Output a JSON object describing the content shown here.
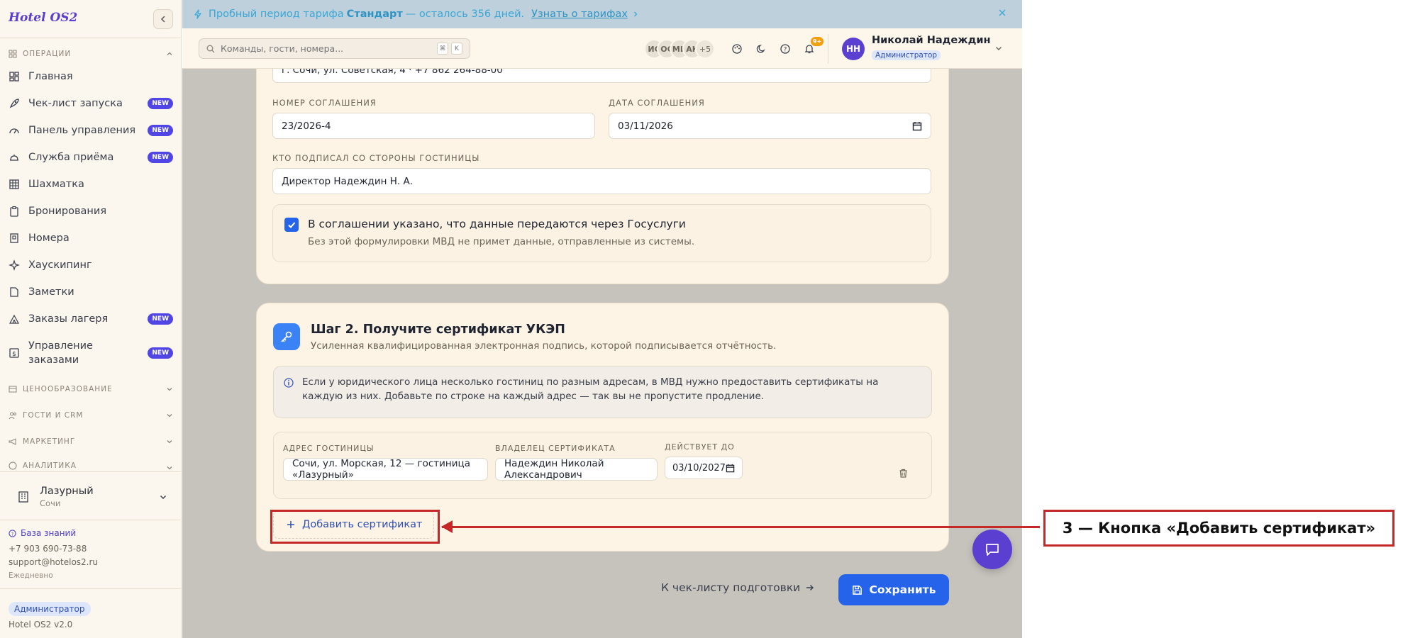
{
  "app": {
    "brand": "Hotel OS2"
  },
  "sidebar": {
    "sections": {
      "operations": "ОПЕРАЦИИ",
      "pricing": "ЦЕНООБРАЗОВАНИЕ",
      "guests": "ГОСТИ И CRM",
      "marketing": "МАРКЕТИНГ",
      "analytics": "АНАЛИТИКА"
    },
    "items": [
      {
        "label": "Главная",
        "badge": "",
        "icon": "dashboard-icon"
      },
      {
        "label": "Чек-лист запуска",
        "badge": "NEW",
        "icon": "rocket-icon"
      },
      {
        "label": "Панель управления",
        "badge": "NEW",
        "icon": "gauge-icon"
      },
      {
        "label": "Служба приёма",
        "badge": "NEW",
        "icon": "bell-icon"
      },
      {
        "label": "Шахматка",
        "badge": "",
        "icon": "grid-icon"
      },
      {
        "label": "Бронирования",
        "badge": "",
        "icon": "clipboard-icon"
      },
      {
        "label": "Номера",
        "badge": "",
        "icon": "building-icon"
      },
      {
        "label": "Хаускипинг",
        "badge": "",
        "icon": "sparkle-icon"
      },
      {
        "label": "Заметки",
        "badge": "",
        "icon": "note-icon"
      },
      {
        "label": "Заказы лагеря",
        "badge": "NEW",
        "icon": "tent-icon"
      },
      {
        "label": "Управление заказами",
        "badge": "NEW",
        "icon": "dollar-icon"
      }
    ],
    "hotel": {
      "name": "Лазурный",
      "city": "Сочи"
    },
    "knowledge_base": "База знаний",
    "phone": "+7 903 690-73-88",
    "email": "support@hotelos2.ru",
    "hours": "Ежедневно",
    "role": "Администратор",
    "version": "Hotel OS2 v2.0"
  },
  "banner": {
    "text_before": "Пробный период тарифа",
    "plan": "Стандарт",
    "text_after": "— осталось 356 дней.",
    "link": "Узнать о тарифах"
  },
  "header": {
    "search_placeholder": "Команды, гости, номера...",
    "kbd1": "⌘",
    "kbd2": "K",
    "avatars": [
      "ИС",
      "ОС",
      "МИ",
      "АК"
    ],
    "avatars_more": "+5",
    "notif_count": "9+",
    "user": {
      "initials": "НН",
      "name": "Николай Надеждин",
      "role": "Администратор"
    }
  },
  "step1": {
    "address_value": "г. Сочи, ул. Советская, 4 · +7 862 264-88-00",
    "agreement_number_label": "НОМЕР СОГЛАШЕНИЯ",
    "agreement_number_value": "23/2026-4",
    "agreement_date_label": "ДАТА СОГЛАШЕНИЯ",
    "agreement_date_value": "03/11/2026",
    "signer_label": "КТО ПОДПИСАЛ СО СТОРОНЫ ГОСТИНИЦЫ",
    "signer_value": "Директор Надеждин Н. А.",
    "checkbox_title": "В соглашении указано, что данные передаются через Госуслуги",
    "checkbox_sub": "Без этой формулировки МВД не примет данные, отправленные из системы.",
    "checkbox_checked": true
  },
  "step2": {
    "title": "Шаг 2. Получите сертификат УКЭП",
    "subtitle": "Усиленная квалифицированная электронная подпись, которой подписывается отчётность.",
    "info": "Если у юридического лица несколько гостиниц по разным адресам, в МВД нужно предоставить сертификаты на каждую из них. Добавьте по строке на каждый адрес — так вы не пропустите продление.",
    "columns": {
      "address": "АДРЕС ГОСТИНИЦЫ",
      "owner": "ВЛАДЕЛЕЦ СЕРТИФИКАТА",
      "valid_until": "ДЕЙСТВУЕТ ДО"
    },
    "rows": [
      {
        "address": "Сочи, ул. Морская, 12 — гостиница «Лазурный»",
        "owner": "Надеждин Николай Александрович",
        "valid_until": "03/10/2027"
      }
    ],
    "add_button": "Добавить сертификат"
  },
  "footer": {
    "checklist_link": "К чек-листу подготовки",
    "save": "Сохранить"
  },
  "annotation": {
    "callout": "3 — Кнопка «Добавить сертификат»",
    "color": "#c62828"
  }
}
